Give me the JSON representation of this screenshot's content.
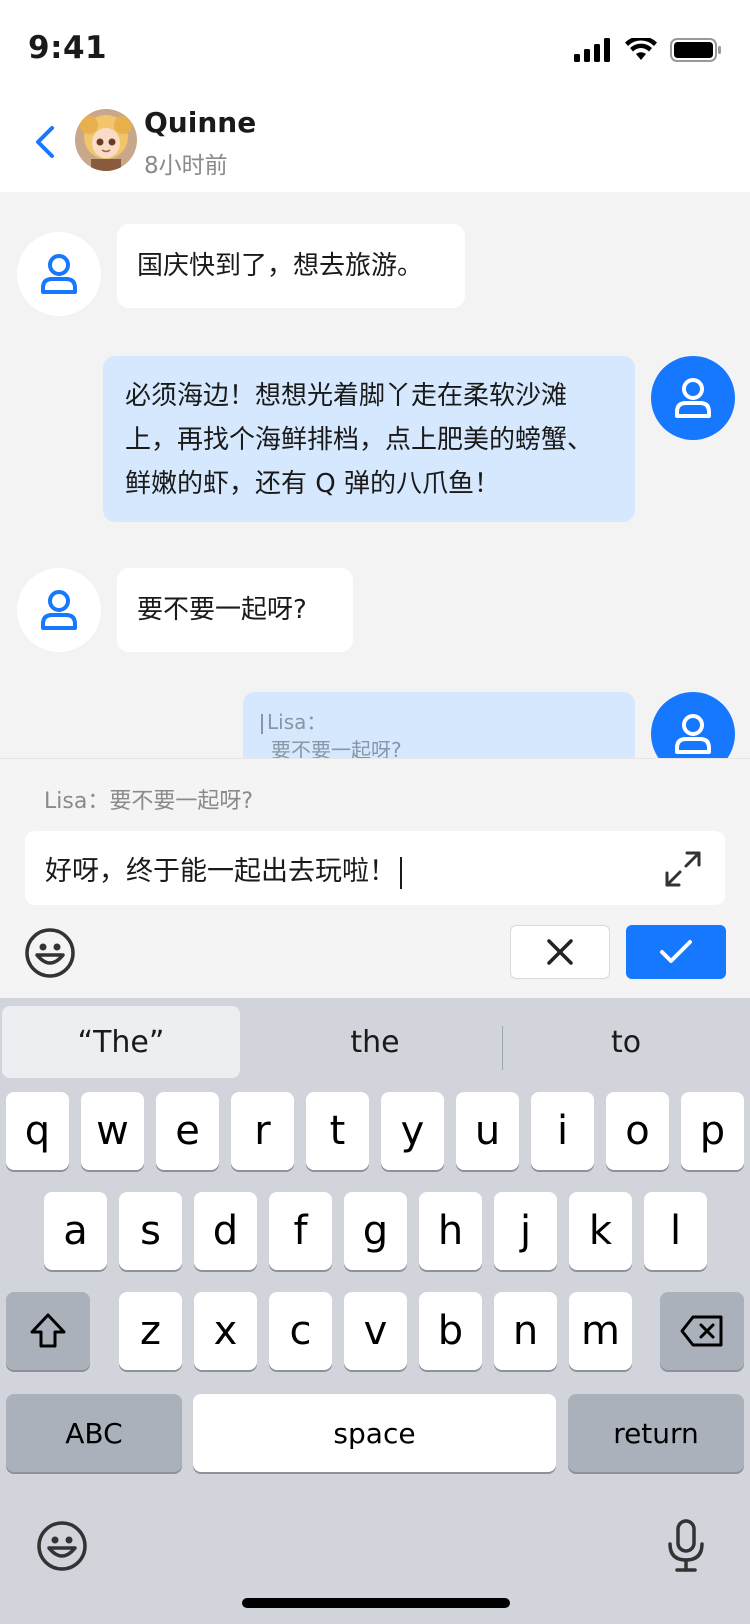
{
  "status_bar": {
    "time": "9:41"
  },
  "header": {
    "name": "Quinne",
    "last_seen": "8小时前"
  },
  "messages": [
    {
      "side": "other",
      "text": "国庆快到了，想去旅游。"
    },
    {
      "side": "self",
      "lines": [
        "必须海边！想想光着脚丫走在柔软沙滩",
        "上，再找个海鲜排档，点上肥美的螃蟹、",
        "鲜嫩的虾，还有 Q 弹的八爪鱼！"
      ]
    },
    {
      "side": "other",
      "text": "要不要一起呀?"
    },
    {
      "side": "self",
      "quote_author": "Lisa：",
      "quote_text": "要不要一起呀?"
    }
  ],
  "reply": {
    "reference": "Lisa：要不要一起呀?",
    "input_value": "好呀，终于能一起出去玩啦！"
  },
  "keyboard": {
    "suggestions": [
      "“The”",
      "the",
      "to"
    ],
    "row1": [
      "q",
      "w",
      "e",
      "r",
      "t",
      "y",
      "u",
      "i",
      "o",
      "p"
    ],
    "row2": [
      "a",
      "s",
      "d",
      "f",
      "g",
      "h",
      "j",
      "k",
      "l"
    ],
    "row3": [
      "z",
      "x",
      "c",
      "v",
      "b",
      "n",
      "m"
    ],
    "abc": "ABC",
    "space": "space",
    "return": "return"
  },
  "colors": {
    "accent": "#1677ff",
    "self_bubble": "#d6e8fd",
    "chat_bg": "#f3f3f3"
  },
  "icons": [
    "back-icon",
    "user-icon",
    "expand-icon",
    "emoji-icon",
    "close-icon",
    "check-icon",
    "shift-icon",
    "backspace-icon",
    "microphone-icon"
  ]
}
